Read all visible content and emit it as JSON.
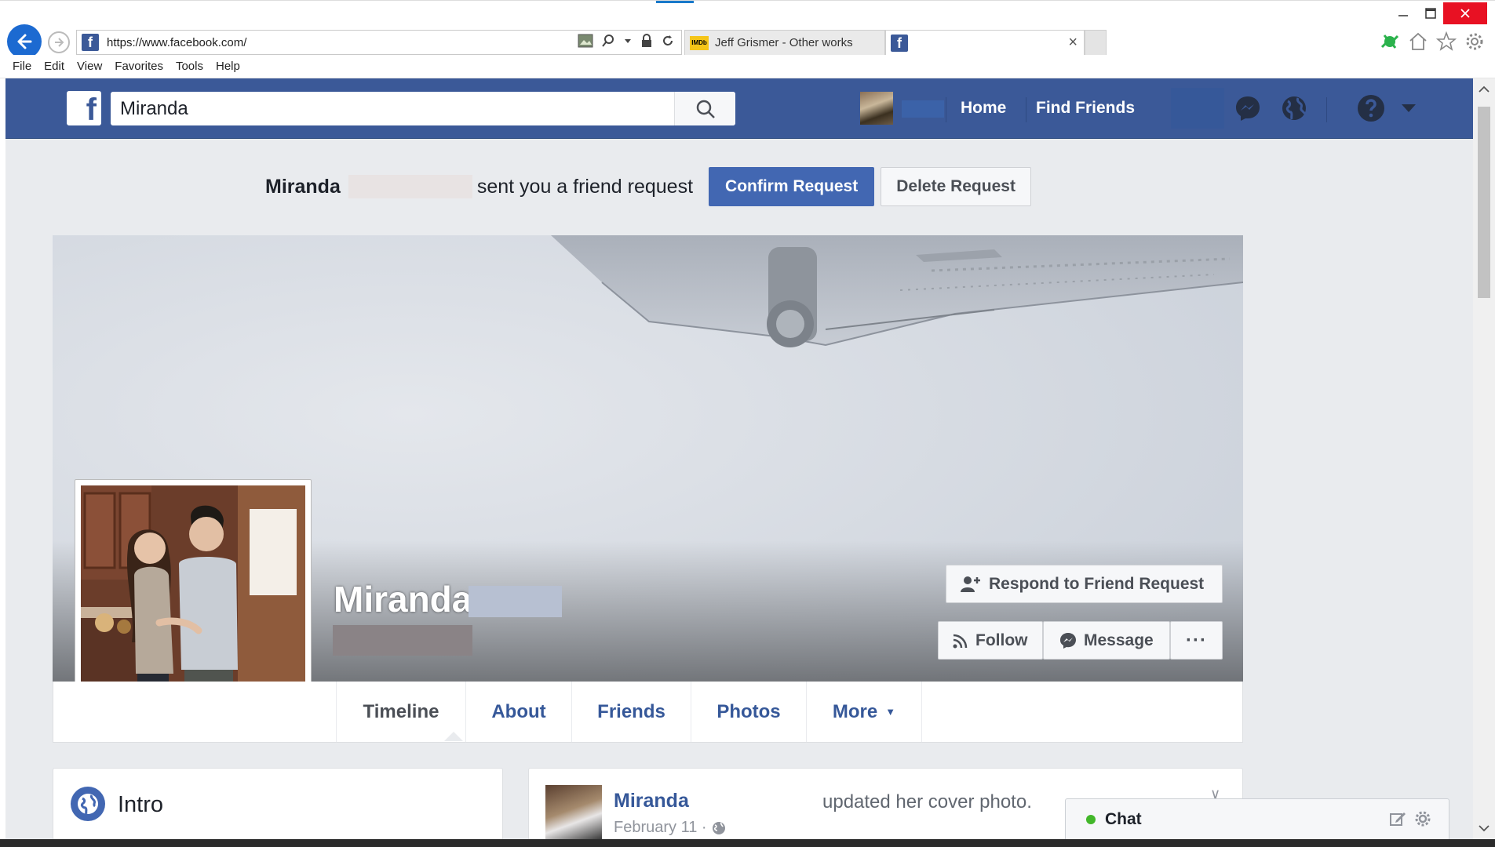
{
  "browser": {
    "address_url": "https://www.facebook.com/",
    "tabs": [
      {
        "label": "Jeff Grismer - Other works",
        "icon": "imdb-icon",
        "badge": "IMDb"
      },
      {
        "label": "",
        "icon": "facebook-favicon"
      }
    ],
    "tab_close": "×",
    "menu": [
      "File",
      "Edit",
      "View",
      "Favorites",
      "Tools",
      "Help"
    ]
  },
  "fb_header": {
    "logo": "f",
    "search_value": "Miranda",
    "nav": [
      "Home",
      "Find Friends"
    ]
  },
  "friend_request": {
    "name": "Miranda",
    "text": "sent you a friend request",
    "confirm_label": "Confirm Request",
    "delete_label": "Delete Request"
  },
  "profile": {
    "name": "Miranda",
    "respond_label": "Respond to Friend Request",
    "follow_label": "Follow",
    "message_label": "Message",
    "more_label": "···",
    "tabs": [
      "Timeline",
      "About",
      "Friends",
      "Photos",
      "More"
    ],
    "more_caret": "▼"
  },
  "intro": {
    "title": "Intro"
  },
  "post": {
    "author": "Miranda",
    "action": "updated her cover photo.",
    "date": "February 11 ·",
    "chevron": "∨"
  },
  "chat": {
    "label": "Chat"
  },
  "colors": {
    "facebook_blue": "#3b5998",
    "confirm_blue": "#4267b2",
    "link_blue": "#365899",
    "ie_back_blue": "#1c6ad1",
    "close_red": "#e81123",
    "online_green": "#42b72a"
  }
}
